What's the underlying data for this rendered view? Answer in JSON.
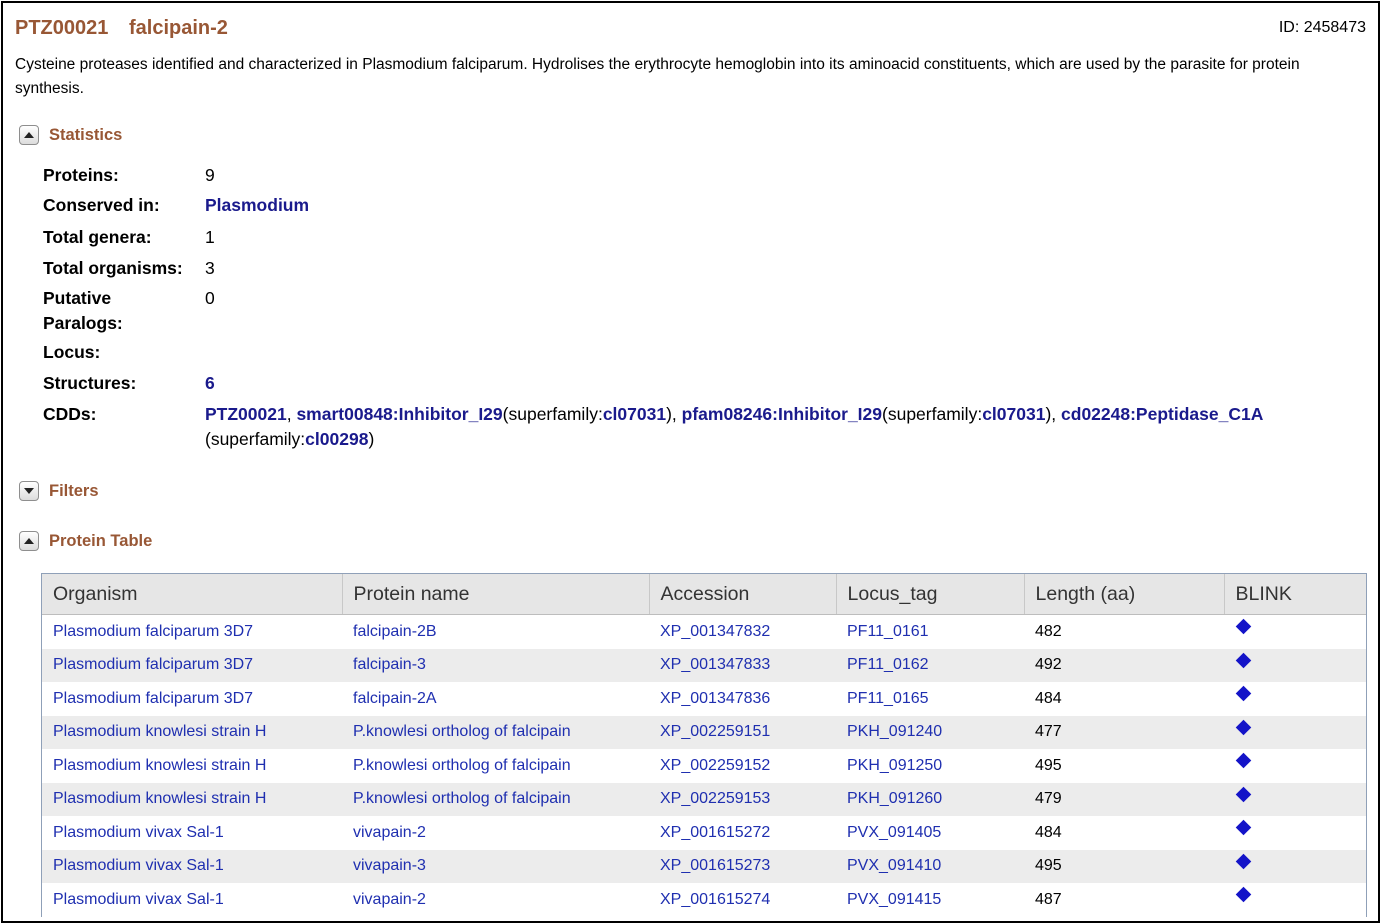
{
  "header": {
    "accession": "PTZ00021",
    "name": "falcipain-2",
    "id_label": "ID: 2458473"
  },
  "description": "Cysteine proteases identified and characterized in Plasmodium falciparum. Hydrolises the erythrocyte hemoglobin into its aminoacid constituents, which are used by the parasite for protein synthesis.",
  "sections": {
    "statistics": "Statistics",
    "filters": "Filters",
    "protein_table": "Protein Table"
  },
  "statistics": {
    "proteins_label": "Proteins:",
    "proteins_value": "9",
    "conserved_label": "Conserved in:",
    "conserved_value": "Plasmodium",
    "genera_label": "Total genera:",
    "genera_value": "1",
    "organisms_label": "Total organisms:",
    "organisms_value": "3",
    "paralogs_label_line1": "Putative",
    "paralogs_label_line2": "Paralogs:",
    "paralogs_value": "0",
    "locus_label": "Locus:",
    "structures_label": "Structures:",
    "structures_value": "6",
    "cdds_label": "CDDs:",
    "cdds": {
      "c1": "PTZ00021",
      "sep1": ", ",
      "c2": "smart00848:Inhibitor_I29",
      "c2_pre": "(superfamily:",
      "c2_sf": "cl07031",
      "c2_post": "), ",
      "c3": "pfam08246:Inhibitor_I29",
      "c3_pre": "(superfamily:",
      "c3_sf": "cl07031",
      "c3_post": "), ",
      "c4": "cd02248:Peptidase_C1A",
      "c4_pre": " (superfamily:",
      "c4_sf": "cl00298",
      "c4_post": ")"
    }
  },
  "protein_table": {
    "columns": [
      "Organism",
      "Protein name",
      "Accession",
      "Locus_tag",
      "Length (aa)",
      "BLINK"
    ],
    "rows": [
      {
        "organism": "Plasmodium falciparum 3D7",
        "protein": "falcipain-2B",
        "accession": "XP_001347832",
        "locus": "PF11_0161",
        "length": "482"
      },
      {
        "organism": "Plasmodium falciparum 3D7",
        "protein": "falcipain-3",
        "accession": "XP_001347833",
        "locus": "PF11_0162",
        "length": "492"
      },
      {
        "organism": "Plasmodium falciparum 3D7",
        "protein": "falcipain-2A",
        "accession": "XP_001347836",
        "locus": "PF11_0165",
        "length": "484"
      },
      {
        "organism": "Plasmodium knowlesi strain H",
        "protein": "P.knowlesi ortholog of falcipain",
        "accession": "XP_002259151",
        "locus": "PKH_091240",
        "length": "477"
      },
      {
        "organism": "Plasmodium knowlesi strain H",
        "protein": "P.knowlesi ortholog of falcipain",
        "accession": "XP_002259152",
        "locus": "PKH_091250",
        "length": "495"
      },
      {
        "organism": "Plasmodium knowlesi strain H",
        "protein": "P.knowlesi ortholog of falcipain",
        "accession": "XP_002259153",
        "locus": "PKH_091260",
        "length": "479"
      },
      {
        "organism": "Plasmodium vivax Sal-1",
        "protein": "vivapain-2",
        "accession": "XP_001615272",
        "locus": "PVX_091405",
        "length": "484"
      },
      {
        "organism": "Plasmodium vivax Sal-1",
        "protein": "vivapain-3",
        "accession": "XP_001615273",
        "locus": "PVX_091410",
        "length": "495"
      },
      {
        "organism": "Plasmodium vivax Sal-1",
        "protein": "vivapain-2",
        "accession": "XP_001615274",
        "locus": "PVX_091415",
        "length": "487"
      }
    ]
  },
  "icons": {
    "blink": "diamond-icon",
    "collapse": "triangle-up-icon",
    "expand": "triangle-down-icon"
  },
  "colors": {
    "title_brown": "#985735",
    "stat_link": "#1a1a8c",
    "table_link": "#1f2fb0",
    "blink_diamond": "#1414c8",
    "row_alt": "#ececec",
    "header_bg": "#e6e6e6"
  }
}
